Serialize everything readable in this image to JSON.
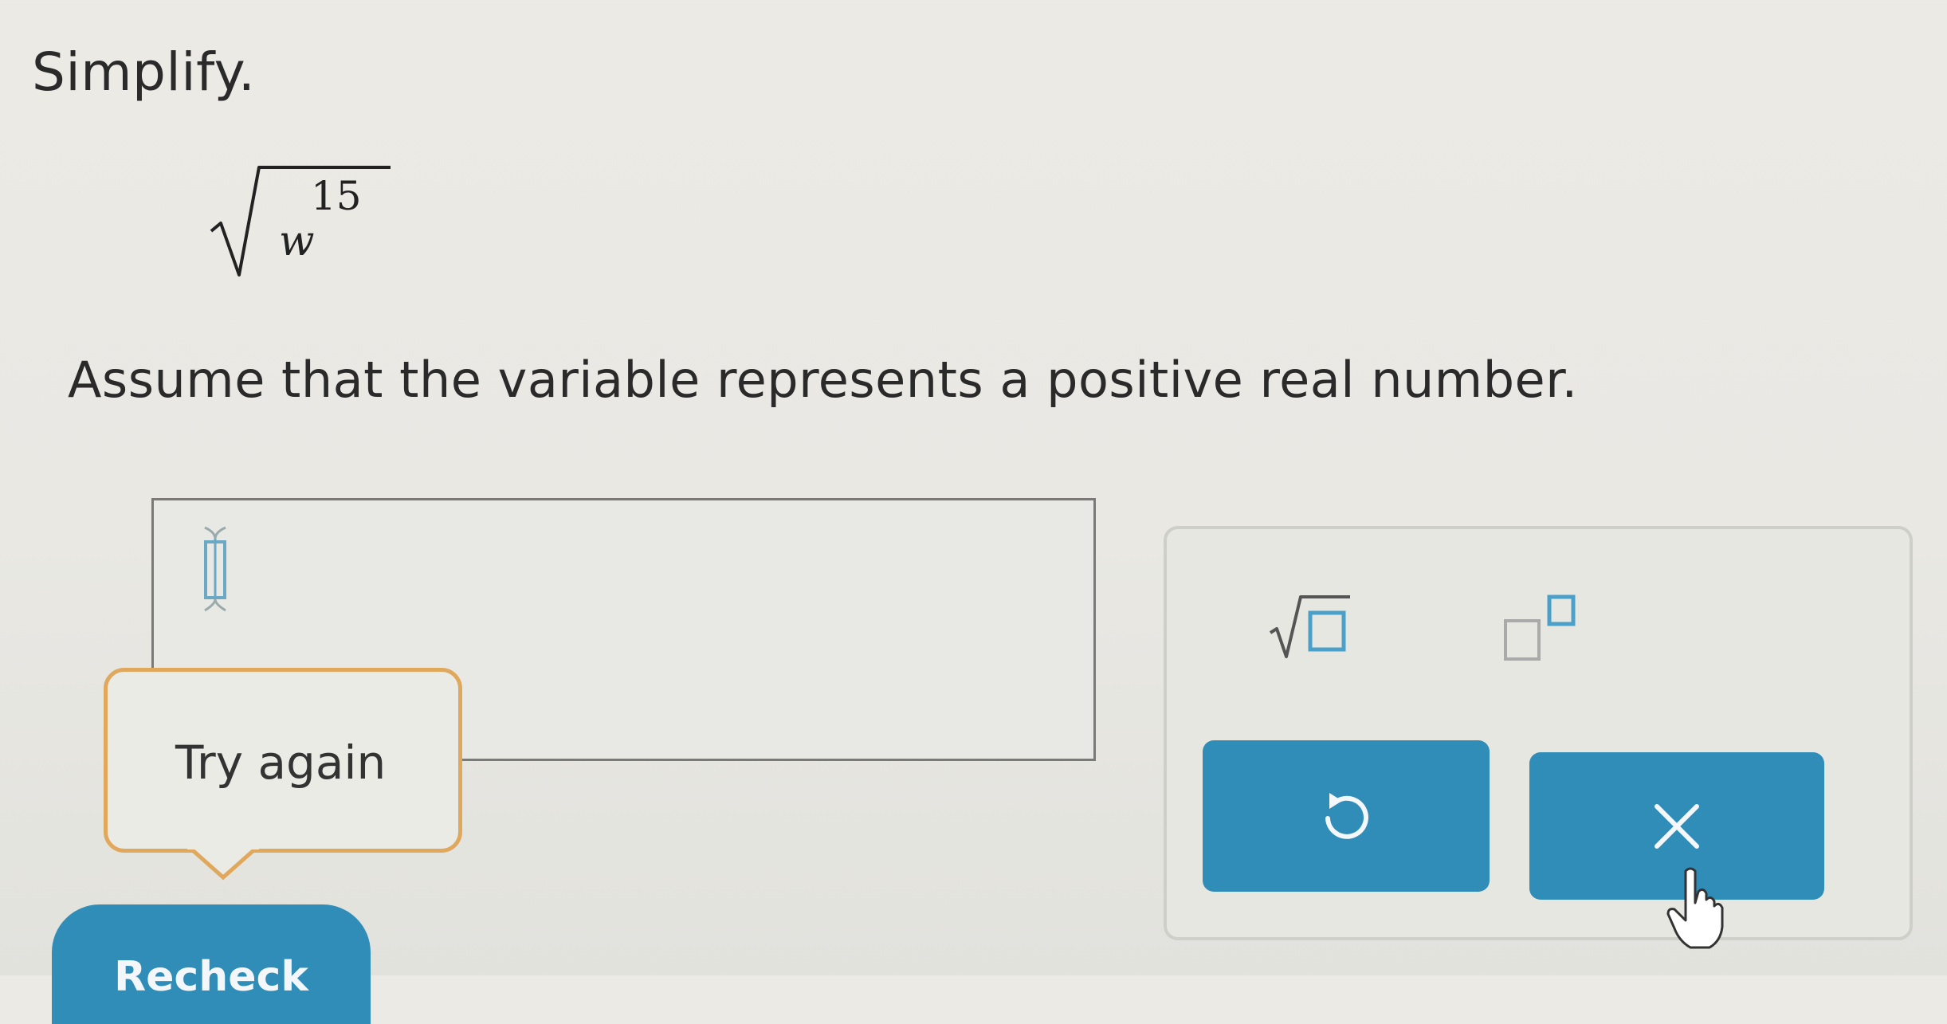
{
  "question": {
    "instruction": "Simplify.",
    "expression": {
      "operator_icon": "square-root-icon",
      "base": "w",
      "exponent": "15"
    },
    "assumption": "Assume that the variable represents a positive real number."
  },
  "answer": {
    "value": "",
    "caret_icon": "text-caret-icon"
  },
  "feedback": {
    "text": "Try again",
    "border_color": "#e0a85c"
  },
  "keypad": {
    "keys": [
      {
        "name": "square-root-key",
        "icon": "square-root-template-icon"
      },
      {
        "name": "exponent-key",
        "icon": "exponent-template-icon"
      },
      {
        "name": "reset-key",
        "icon": "undo-icon"
      },
      {
        "name": "clear-key",
        "icon": "close-icon"
      }
    ],
    "button_color": "#2f8db8"
  },
  "actions": {
    "recheck_label": "Recheck"
  },
  "cursor_icon": "hand-pointer-icon"
}
